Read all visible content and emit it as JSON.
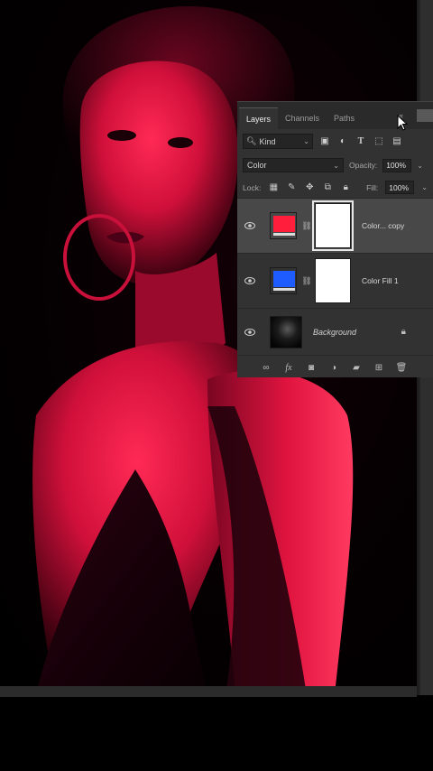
{
  "layers_panel": {
    "tabs": [
      {
        "label": "Layers",
        "active": true
      },
      {
        "label": "Channels",
        "active": false
      },
      {
        "label": "Paths",
        "active": false
      }
    ],
    "filter": {
      "kind_label": "Kind"
    },
    "blend_mode": "Color",
    "opacity_label": "Opacity:",
    "opacity_value": "100%",
    "lock_label": "Lock:",
    "fill_label": "Fill:",
    "fill_value": "100%",
    "layers": [
      {
        "name": "Color... copy",
        "swatch_color": "#ff1f3c",
        "selected": true,
        "visible": true
      },
      {
        "name": "Color Fill 1",
        "swatch_color": "#1f5cff",
        "selected": false,
        "visible": true
      },
      {
        "name": "Background",
        "selected": false,
        "visible": true,
        "locked": true
      }
    ]
  },
  "colors": {
    "accent_red": "#e8123c",
    "panel_bg": "#323232"
  }
}
